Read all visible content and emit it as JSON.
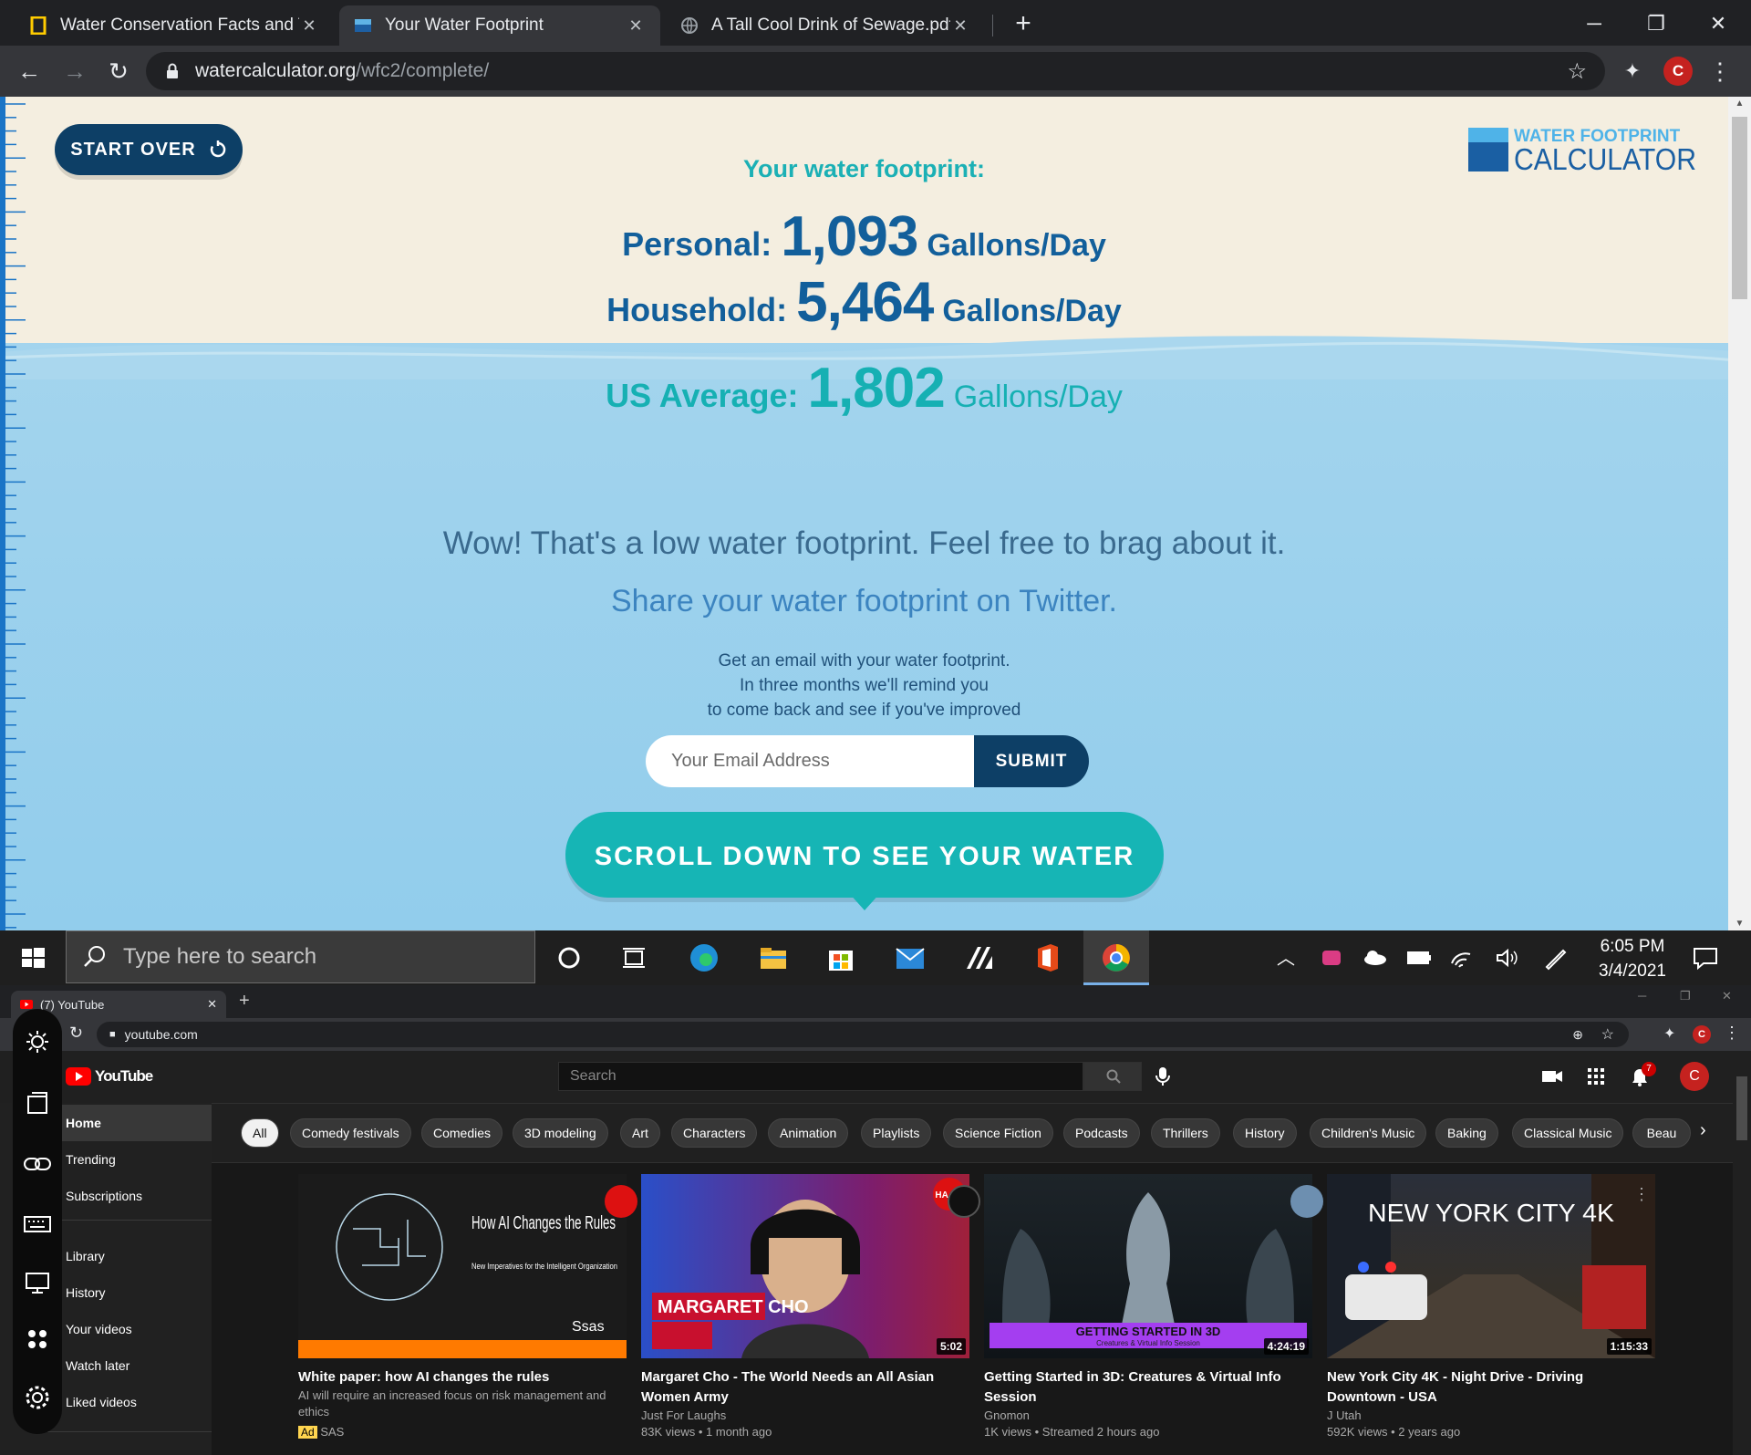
{
  "browser_top": {
    "tabs": [
      {
        "title": "Water Conservation Facts and Tip",
        "close": "✕"
      },
      {
        "title": "Your Water Footprint",
        "close": "✕"
      },
      {
        "title": "A Tall Cool Drink of Sewage.pdf",
        "close": "✕"
      }
    ],
    "new_tab": "+",
    "url_domain": "watercalculator.org",
    "url_path": "/wfc2/complete/",
    "profile_initial": "C"
  },
  "page": {
    "start_over_label": "START OVER",
    "logo_line1": "WATER FOOTPRINT",
    "logo_line2": "CALCULATOR",
    "footprint_title": "Your water footprint:",
    "personal": {
      "label": "Personal:",
      "value": "1,093",
      "unit": "Gallons/Day"
    },
    "household": {
      "label": "Household:",
      "value": "5,464",
      "unit": "Gallons/Day"
    },
    "us_average": {
      "label": "US Average:",
      "value": "1,802",
      "unit": "Gallons/Day"
    },
    "message": "Wow! That's a low water footprint. Feel free to brag about it.",
    "share_link": "Share your water footprint on Twitter.",
    "email_lines": [
      "Get an email with your water footprint.",
      "In three months we'll remind you",
      "to come back and see if you've improved"
    ],
    "email_placeholder": "Your Email Address",
    "submit_label": "SUBMIT",
    "scroll_label": "SCROLL DOWN TO SEE YOUR WATER USE"
  },
  "taskbar": {
    "search_placeholder": "Type here to search",
    "time": "6:05 PM",
    "date": "3/4/2021"
  },
  "browser_bottom": {
    "tab_title": "(7) YouTube",
    "url": "youtube.com",
    "profile_initial": "C"
  },
  "youtube": {
    "logo": "YouTube",
    "search_placeholder": "Search",
    "notification_count": "7",
    "profile_initial": "C",
    "sidebar": [
      "Home",
      "Trending",
      "Subscriptions",
      "Library",
      "History",
      "Your videos",
      "Watch later",
      "Liked videos"
    ],
    "chips": [
      "All",
      "Comedy festivals",
      "Comedies",
      "3D modeling",
      "Art",
      "Characters",
      "Animation",
      "Playlists",
      "Science Fiction",
      "Podcasts",
      "Thrillers",
      "History",
      "Children's Music",
      "Baking",
      "Classical Music",
      "Beau"
    ],
    "videos": [
      {
        "thumb_title": "How AI Changes the Rules",
        "thumb_sub": "New Imperatives for the Intelligent Organization",
        "thumb_brand": "Ssas",
        "title": "White paper: how AI changes the rules",
        "desc": "AI will require an increased focus on risk management and ethics",
        "ad": "Ad",
        "channel": "SAS",
        "duration": ""
      },
      {
        "thumb_text": "MARGARET CHO",
        "thumb_badge": "HA HA",
        "title": "Margaret Cho - The World Needs an All Asian Women Army",
        "channel": "Just For Laughs",
        "meta": "83K views • 1 month ago",
        "duration": "5:02"
      },
      {
        "thumb_text": "GETTING STARTED IN 3D",
        "thumb_sub": "Creatures & Virtual Info Session",
        "title": "Getting Started in 3D: Creatures & Virtual Info Session",
        "channel": "Gnomon",
        "meta": "1K views • Streamed 2 hours ago",
        "duration": "4:24:19"
      },
      {
        "thumb_text": "NEW YORK CITY 4K",
        "title": "New York City 4K - Night Drive - Driving Downtown - USA",
        "channel": "J Utah",
        "meta": "592K views • 2 years ago",
        "duration": "1:15:33"
      }
    ]
  },
  "colors": {
    "navy": "#0d3f66",
    "blue_text": "#125f9b",
    "teal": "#16b0b3",
    "beige": "#f4eee0",
    "water": "#9fd3ee"
  }
}
